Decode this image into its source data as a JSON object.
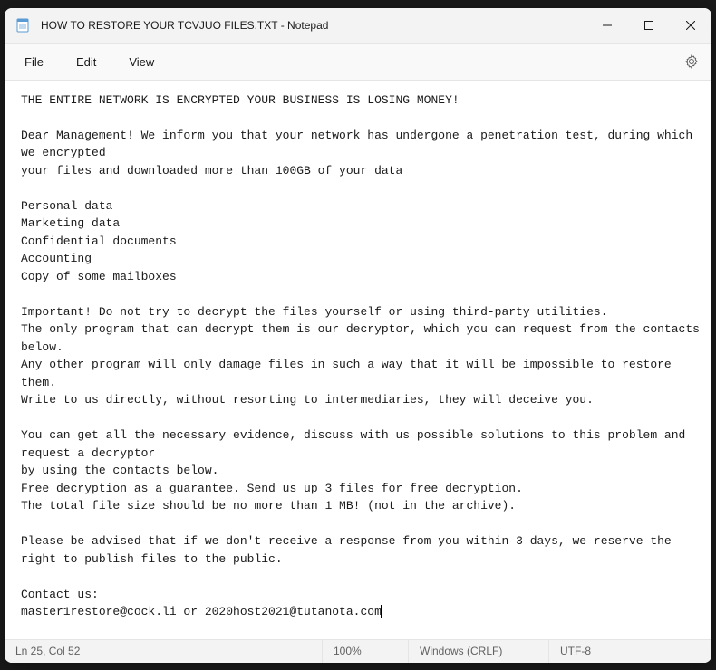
{
  "titlebar": {
    "title": "HOW TO RESTORE YOUR TCVJUO FILES.TXT - Notepad"
  },
  "menu": {
    "file": "File",
    "edit": "Edit",
    "view": "View"
  },
  "editor": {
    "content": "THE ENTIRE NETWORK IS ENCRYPTED YOUR BUSINESS IS LOSING MONEY!\n\nDear Management! We inform you that your network has undergone a penetration test, during which we encrypted\nyour files and downloaded more than 100GB of your data\n\nPersonal data\nMarketing data\nConfidential documents\nAccounting\nCopy of some mailboxes\n\nImportant! Do not try to decrypt the files yourself or using third-party utilities.\nThe only program that can decrypt them is our decryptor, which you can request from the contacts below.\nAny other program will only damage files in such a way that it will be impossible to restore them.\nWrite to us directly, without resorting to intermediaries, they will deceive you.\n\nYou can get all the necessary evidence, discuss with us possible solutions to this problem and request a decryptor\nby using the contacts below.\nFree decryption as a guarantee. Send us up 3 files for free decryption.\nThe total file size should be no more than 1 MB! (not in the archive).\n\nPlease be advised that if we don't receive a response from you within 3 days, we reserve the right to publish files to the public.\n\nContact us:\nmaster1restore@cock.li or 2020host2021@tutanota.com"
  },
  "statusbar": {
    "cursor": "Ln 25, Col 52",
    "zoom": "100%",
    "lineending": "Windows (CRLF)",
    "encoding": "UTF-8"
  }
}
